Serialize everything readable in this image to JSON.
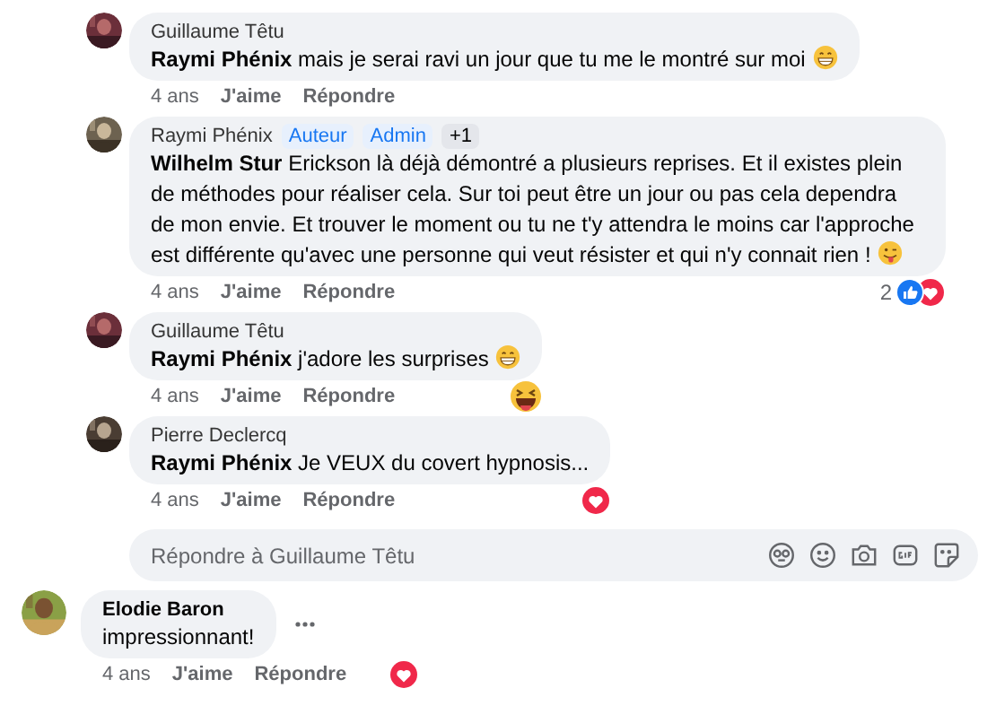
{
  "replies": [
    {
      "author": "Guillaume Têtu",
      "text": "**Raymi Phénix** mais je serai ravi un jour que tu me le montré sur moi",
      "end_emoji": {
        "kind": "grin"
      },
      "time": "4 ans",
      "like": "J'aime",
      "reply": "Répondre"
    },
    {
      "author": "Raymi Phénix",
      "badges": [
        "Auteur",
        "Admin",
        "+1"
      ],
      "text": "**Wilhelm Stur** Erickson là déjà démontré a plusieurs reprises. Et il existes plein de méthodes pour réaliser cela. Sur toi peut être un jour ou pas cela dependra de mon envie. Et trouver le moment ou tu ne t'y attendra le moins car l'approche est différente qu'avec une personne qui veut résister et qui n'y connait rien !",
      "end_emoji": {
        "kind": "tongue"
      },
      "time": "4 ans",
      "like": "J'aime",
      "reply": "Répondre",
      "reaction": {
        "kind": "like_heart",
        "count": "2"
      }
    },
    {
      "author": "Guillaume Têtu",
      "text": "**Raymi Phénix** j'adore les surprises",
      "end_emoji": {
        "kind": "grin"
      },
      "time": "4 ans",
      "like": "J'aime",
      "reply": "Répondre",
      "reaction": {
        "kind": "laugh"
      }
    },
    {
      "author": "Pierre Declercq",
      "text": "**Raymi Phénix** Je VEUX du covert hypnosis...",
      "time": "4 ans",
      "like": "J'aime",
      "reply": "Répondre",
      "reaction": {
        "kind": "heart"
      }
    }
  ],
  "reply_box": {
    "placeholder": "Répondre à Guillaume Têtu"
  },
  "comments": [
    {
      "author": "Elodie Baron",
      "text": "impressionnant!",
      "time": "4 ans",
      "like": "J'aime",
      "reply": "Répondre",
      "reaction": {
        "kind": "heart"
      },
      "more": true
    }
  ]
}
